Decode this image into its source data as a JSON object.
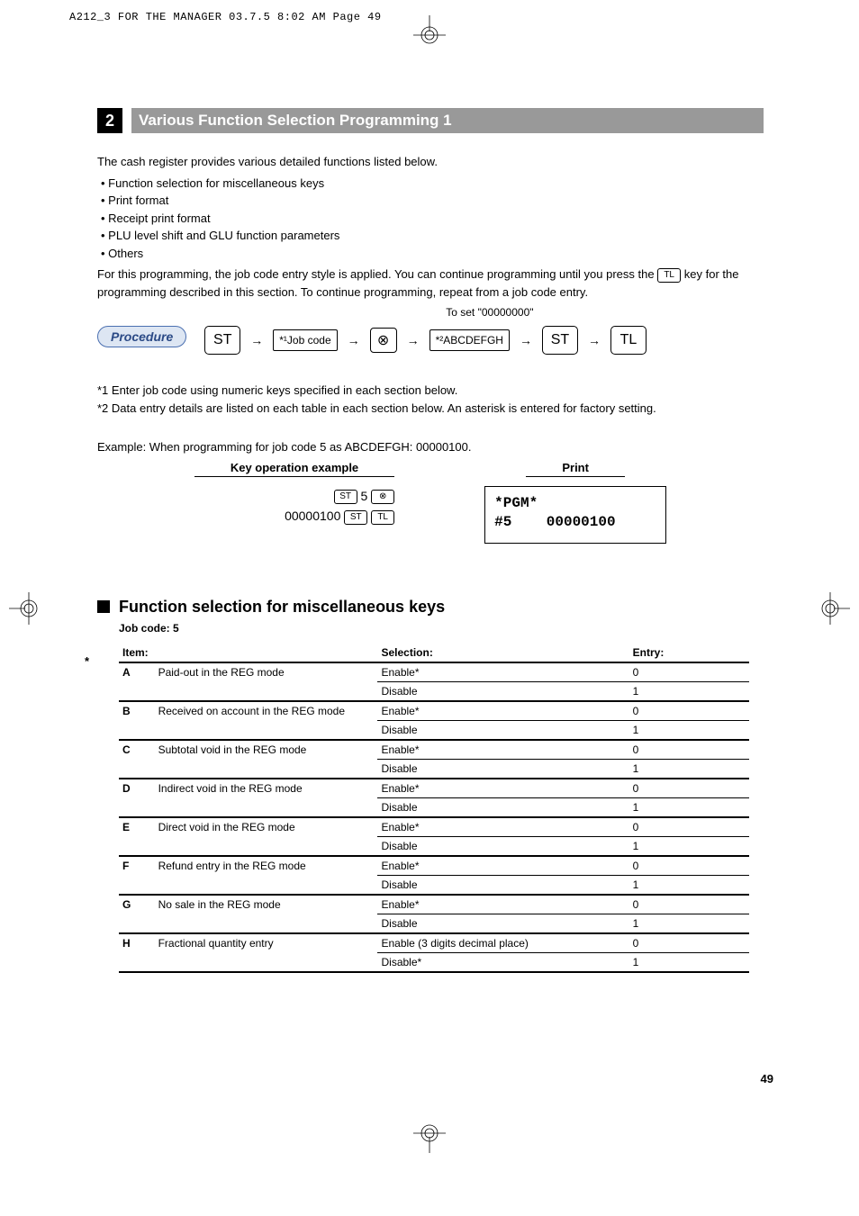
{
  "header_strip": "A212_3 FOR THE MANAGER  03.7.5 8:02 AM  Page 49",
  "section": {
    "number": "2",
    "title": "Various Function Selection Programming 1"
  },
  "intro": {
    "lead": "The cash register provides various detailed functions listed below.",
    "bullets": [
      "Function selection for miscellaneous keys",
      "Print format",
      "Receipt print format",
      "PLU level shift and GLU function parameters",
      "Others"
    ],
    "para_before_key": "For this programming, the job code entry style is applied.  You can continue programming until you press the ",
    "tl_key": "TL",
    "para_after_key": " key for the programming described in this section.  To continue programming, repeat from a job code entry."
  },
  "procedure": {
    "label": "Procedure",
    "st": "ST",
    "jobcode_box": "*¹Job code",
    "abc_box": "*²ABCDEFGH",
    "tl": "TL",
    "to_set": "To set \"00000000\""
  },
  "footnotes": {
    "n1": "*1  Enter job code using numeric keys specified in each section below.",
    "n2": "*2  Data entry details are listed on each table in each section below.  An asterisk is entered for factory setting."
  },
  "example": {
    "lead": "Example:  When programming for job code 5 as ABCDEFGH: 00000100.",
    "key_head": "Key operation example",
    "print_head": "Print",
    "keyop_line1_num": "5",
    "keyop_line2_num": "00000100",
    "st_small": "ST",
    "tl_small": "TL",
    "print_line1": "*PGM*",
    "print_line2_label": "#5",
    "print_line2_value": "00000100"
  },
  "subsection": {
    "title": "Function selection for miscellaneous keys",
    "jobcode": "Job code:  5"
  },
  "table": {
    "headers": {
      "item": "Item:",
      "selection": "Selection:",
      "entry": "Entry:"
    },
    "rows": [
      {
        "letter": "A",
        "item": "Paid-out in the REG mode",
        "options": [
          {
            "sel": "Enable*",
            "entry": "0"
          },
          {
            "sel": "Disable",
            "entry": "1"
          }
        ]
      },
      {
        "letter": "B",
        "item": "Received on account in the REG mode",
        "options": [
          {
            "sel": "Enable*",
            "entry": "0"
          },
          {
            "sel": "Disable",
            "entry": "1"
          }
        ]
      },
      {
        "letter": "C",
        "item": "Subtotal void in the REG mode",
        "options": [
          {
            "sel": "Enable*",
            "entry": "0"
          },
          {
            "sel": "Disable",
            "entry": "1"
          }
        ]
      },
      {
        "letter": "D",
        "item": "Indirect void in the REG mode",
        "options": [
          {
            "sel": "Enable*",
            "entry": "0"
          },
          {
            "sel": "Disable",
            "entry": "1"
          }
        ]
      },
      {
        "letter": "E",
        "item": "Direct void in the REG mode",
        "options": [
          {
            "sel": "Enable*",
            "entry": "0"
          },
          {
            "sel": "Disable",
            "entry": "1"
          }
        ]
      },
      {
        "letter": "F",
        "item": "Refund entry in the REG mode",
        "options": [
          {
            "sel": "Enable*",
            "entry": "0"
          },
          {
            "sel": "Disable",
            "entry": "1"
          }
        ]
      },
      {
        "letter": "G",
        "item": "No sale in the REG mode",
        "options": [
          {
            "sel": "Enable*",
            "entry": "0"
          },
          {
            "sel": "Disable",
            "entry": "1"
          }
        ]
      },
      {
        "letter": "H",
        "item": "Fractional quantity entry",
        "options": [
          {
            "sel": "Enable (3 digits decimal place)",
            "entry": "0"
          },
          {
            "sel": "Disable*",
            "entry": "1"
          }
        ]
      }
    ]
  },
  "page_number": "49"
}
